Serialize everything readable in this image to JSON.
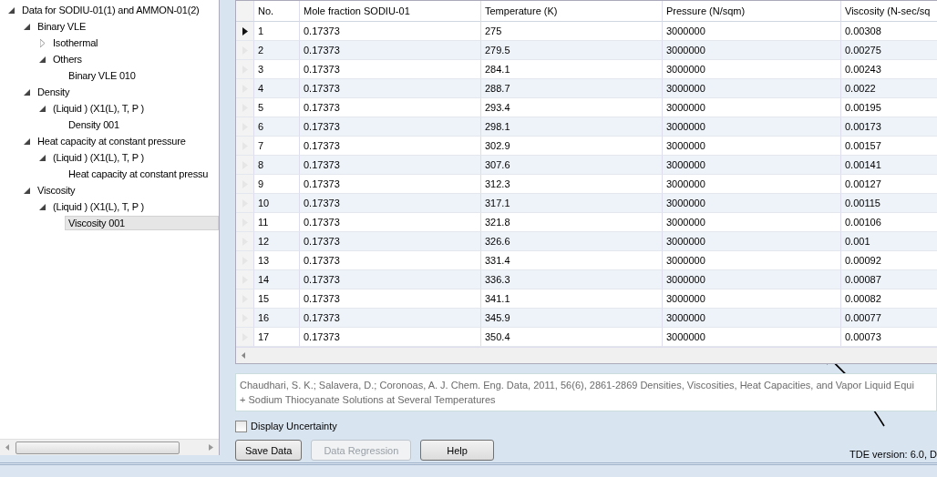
{
  "tree": {
    "items": [
      {
        "label": "Data for SODIU-01(1) and AMMON-01(2)",
        "expanded": true,
        "selected": false,
        "children": [
          {
            "label": "Binary VLE",
            "expanded": true,
            "selected": false,
            "children": [
              {
                "label": "Isothermal",
                "expanded": false,
                "selected": false
              },
              {
                "label": "Others",
                "expanded": true,
                "selected": false,
                "children": [
                  {
                    "label": "Binary VLE 010",
                    "selected": false
                  }
                ]
              }
            ]
          },
          {
            "label": "Density",
            "expanded": true,
            "selected": false,
            "children": [
              {
                "label": "(Liquid ) (X1(L), T, P )",
                "expanded": true,
                "selected": false,
                "children": [
                  {
                    "label": "Density 001",
                    "selected": false
                  }
                ]
              }
            ]
          },
          {
            "label": "Heat capacity at constant pressure",
            "expanded": true,
            "selected": false,
            "children": [
              {
                "label": "(Liquid ) (X1(L), T, P )",
                "expanded": true,
                "selected": false,
                "children": [
                  {
                    "label": "Heat capacity at constant pressu",
                    "selected": false
                  }
                ]
              }
            ]
          },
          {
            "label": "Viscosity",
            "expanded": true,
            "selected": false,
            "children": [
              {
                "label": "(Liquid ) (X1(L), T, P )",
                "expanded": true,
                "selected": false,
                "children": [
                  {
                    "label": "Viscosity 001",
                    "selected": true
                  }
                ]
              }
            ]
          }
        ]
      }
    ]
  },
  "table": {
    "columns": [
      "No.",
      "Mole fraction SODIU-01",
      "Temperature (K)",
      "Pressure (N/sqm)",
      "Viscosity (N-sec/sq"
    ],
    "rows": [
      {
        "selected": true,
        "cells": [
          "1",
          "0.17373",
          "275",
          "3000000",
          "0.00308"
        ]
      },
      {
        "selected": false,
        "cells": [
          "2",
          "0.17373",
          "279.5",
          "3000000",
          "0.00275"
        ]
      },
      {
        "selected": false,
        "cells": [
          "3",
          "0.17373",
          "284.1",
          "3000000",
          "0.00243"
        ]
      },
      {
        "selected": false,
        "cells": [
          "4",
          "0.17373",
          "288.7",
          "3000000",
          "0.0022"
        ]
      },
      {
        "selected": false,
        "cells": [
          "5",
          "0.17373",
          "293.4",
          "3000000",
          "0.00195"
        ]
      },
      {
        "selected": false,
        "cells": [
          "6",
          "0.17373",
          "298.1",
          "3000000",
          "0.00173"
        ]
      },
      {
        "selected": false,
        "cells": [
          "7",
          "0.17373",
          "302.9",
          "3000000",
          "0.00157"
        ]
      },
      {
        "selected": false,
        "cells": [
          "8",
          "0.17373",
          "307.6",
          "3000000",
          "0.00141"
        ]
      },
      {
        "selected": false,
        "cells": [
          "9",
          "0.17373",
          "312.3",
          "3000000",
          "0.00127"
        ]
      },
      {
        "selected": false,
        "cells": [
          "10",
          "0.17373",
          "317.1",
          "3000000",
          "0.00115"
        ]
      },
      {
        "selected": false,
        "cells": [
          "11",
          "0.17373",
          "321.8",
          "3000000",
          "0.00106"
        ]
      },
      {
        "selected": false,
        "cells": [
          "12",
          "0.17373",
          "326.6",
          "3000000",
          "0.001"
        ]
      },
      {
        "selected": false,
        "cells": [
          "13",
          "0.17373",
          "331.4",
          "3000000",
          "0.00092"
        ]
      },
      {
        "selected": false,
        "cells": [
          "14",
          "0.17373",
          "336.3",
          "3000000",
          "0.00087"
        ]
      },
      {
        "selected": false,
        "cells": [
          "15",
          "0.17373",
          "341.1",
          "3000000",
          "0.00082"
        ]
      },
      {
        "selected": false,
        "cells": [
          "16",
          "0.17373",
          "345.9",
          "3000000",
          "0.00077"
        ]
      },
      {
        "selected": false,
        "cells": [
          "17",
          "0.17373",
          "350.4",
          "3000000",
          "0.00073"
        ]
      }
    ]
  },
  "citation": [
    "Chaudhari, S. K.; Salavera, D.; Coronoas, A. J. Chem. Eng. Data, 2011, 56(6), 2861-2869 Densities, Viscosities, Heat Capacities, and Vapor Liquid Equi",
    "+ Sodium Thiocyanate Solutions at Several Temperatures"
  ],
  "display_uncertainty": {
    "label": "Display Uncertainty",
    "checked": false
  },
  "buttons": [
    {
      "label": "Save Data",
      "disabled": false
    },
    {
      "label": "Data Regression",
      "disabled": true
    },
    {
      "label": "Help",
      "disabled": false
    }
  ],
  "version": "TDE version: 6.0, D"
}
